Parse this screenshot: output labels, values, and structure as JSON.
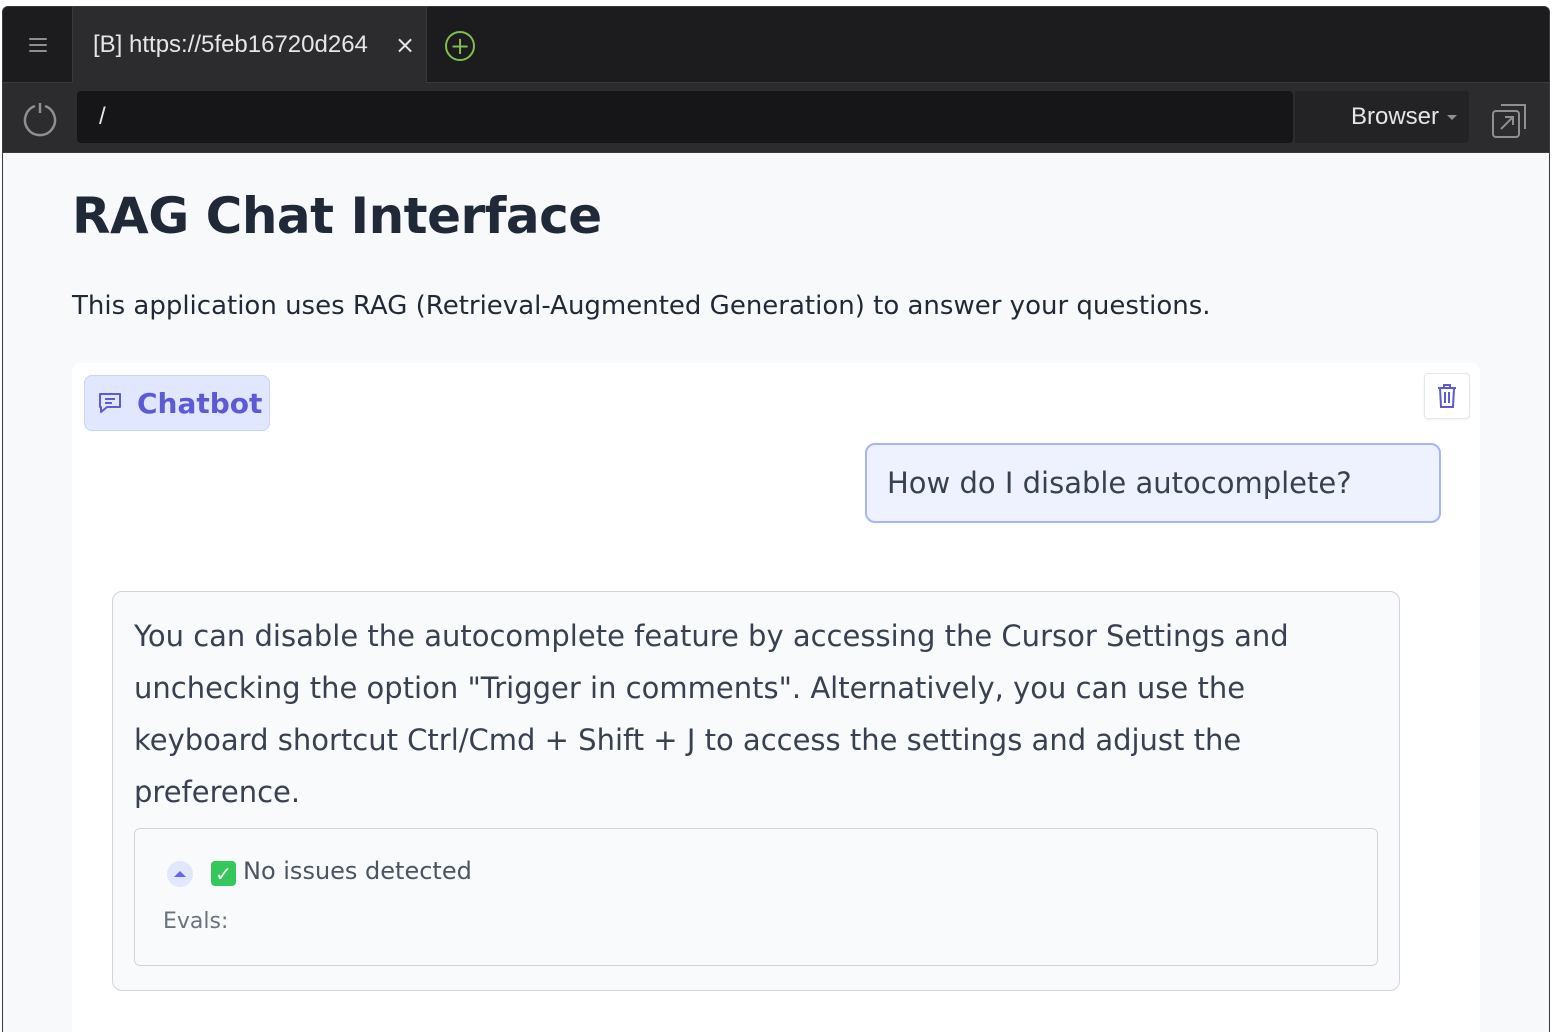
{
  "browser": {
    "tab_title": "[B] https://5feb16720d264",
    "tab_close": "×",
    "new_tab": "+",
    "url": "/",
    "mode_select": "Browser"
  },
  "page": {
    "title": "RAG Chat Interface",
    "description": "This application uses RAG (Retrieval-Augmented Generation) to answer your questions."
  },
  "chatbot": {
    "label": "Chatbot",
    "messages": [
      {
        "role": "user",
        "text": "How do I disable autocomplete?"
      },
      {
        "role": "bot",
        "text": "You can disable the autocomplete feature by accessing the Cursor Settings and unchecking the option \"Trigger in comments\". Alternatively, you can use the keyboard shortcut Ctrl/Cmd + Shift + J to access the settings and adjust the preference."
      }
    ],
    "eval": {
      "check": "✓",
      "status": "No issues detected",
      "label": "Evals:"
    }
  },
  "colors": {
    "accent": "#5b5bd6",
    "new_tab_green": "#7dbf4e",
    "check_green": "#34c759"
  }
}
